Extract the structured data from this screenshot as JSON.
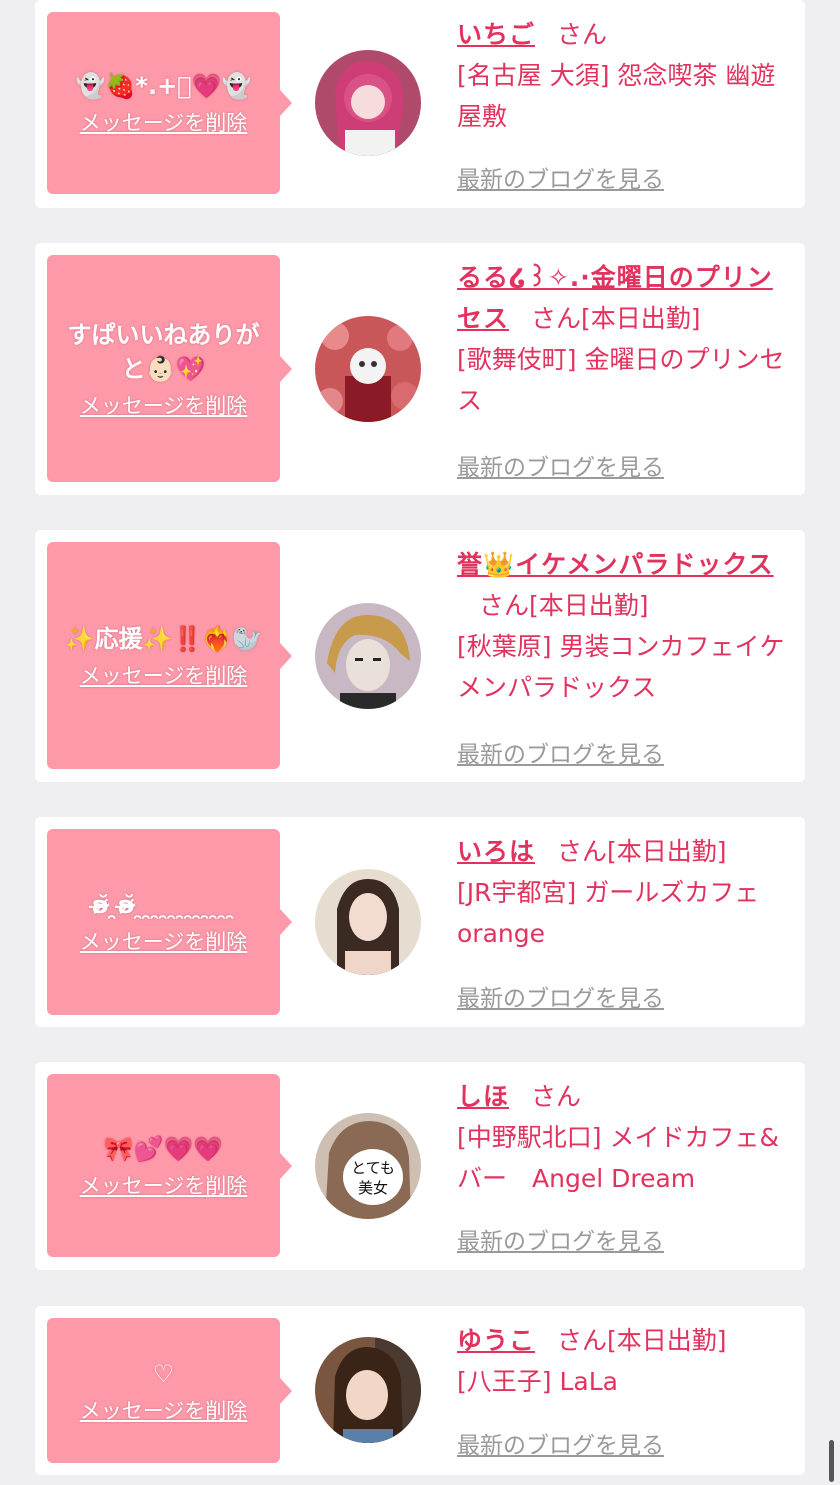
{
  "items": [
    {
      "message": "👻🍓*.+ﾟ💗👻",
      "delete_label": "メッセージを削除",
      "name": "いちご",
      "san": "さん",
      "status": "",
      "shop": "[名古屋 大須] 怨念喫茶 幽遊屋敷",
      "blog_link": "最新のブログを見る"
    },
    {
      "message": "すぱいいねありがと👶🏻💖",
      "delete_label": "メッセージを削除",
      "name": "るる໒꒱✧.·金曜日のプリンセス",
      "san": "さん",
      "status": "[本日出勤]",
      "shop": "[歌舞伎町] 金曜日のプリンセス",
      "blog_link": "最新のブログを見る"
    },
    {
      "message": "✨応援✨‼️❤️‍🔥🦭",
      "delete_label": "メッセージを削除",
      "name": "誉👑イケメンパラドックス",
      "san": "さん",
      "status": "[本日出勤]",
      "shop": "[秋葉原] 男装コンカフェイケメンパラドックス",
      "blog_link": "最新のブログを見る"
    },
    {
      "message": "ʚ̴̶̷̆ ̯ʚ̴̶̷̆ ̯ ̯ ̯ ̯ ̯ ̯ ̯ ̯ ̯ ̯ ̯ ̯",
      "delete_label": "メッセージを削除",
      "name": "いろは",
      "san": "さん",
      "status": "[本日出勤]",
      "shop": "[JR宇都宮] ガールズカフェ orange",
      "blog_link": "最新のブログを見る"
    },
    {
      "message": "🎀💕💗💗",
      "delete_label": "メッセージを削除",
      "name": "しほ",
      "san": "さん",
      "status": "",
      "shop": "[中野駅北口] メイドカフェ&バー　Angel Dream",
      "blog_link": "最新のブログを見る"
    },
    {
      "message": "♡",
      "delete_label": "メッセージを削除",
      "name": "ゆうこ",
      "san": "さん",
      "status": "[本日出勤]",
      "shop": "[八王子] LaLa",
      "blog_link": "最新のブログを見る"
    }
  ],
  "avatar_text_4": "とても美女",
  "colors": {
    "accent": "#e2325e",
    "bubble": "#fd99a9",
    "background": "#efeef0",
    "link_gray": "#9a9a9a"
  }
}
